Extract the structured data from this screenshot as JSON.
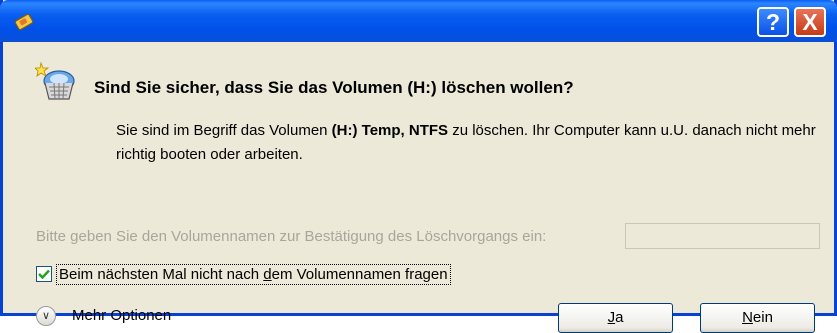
{
  "titlebar": {
    "help_glyph": "?",
    "close_glyph": "X"
  },
  "dialog": {
    "heading": "Sind Sie sicher, dass Sie das Volumen (H:) löschen wollen?",
    "desc_1": "Sie sind im Begriff das Volumen ",
    "desc_bold": "(H:) Temp, NTFS",
    "desc_2": " zu löschen. Ihr Computer kann u.U. danach nicht mehr richtig booten oder arbeiten.",
    "confirm_label": "Bitte geben Sie den Volumennamen zur Bestätigung des Löschvorgangs ein:",
    "confirm_value": "",
    "checkbox_label_pre": "Beim nächsten Mal nicht nach ",
    "checkbox_label_accel": "d",
    "checkbox_label_post": "em Volumennamen fragen",
    "checkbox_checked": true,
    "more_options": "Mehr Optionen",
    "yes_accel": "J",
    "yes_rest": "a",
    "no_accel": "N",
    "no_rest": "ein"
  },
  "icons": {
    "app": "app-icon",
    "warning": "delete-volume-icon",
    "expand": "chevron-down-icon"
  },
  "colors": {
    "titlebar": "#0a5ef0",
    "dialog_bg": "#ece9d8",
    "disabled_text": "#a7a69a",
    "check": "#21a121"
  }
}
